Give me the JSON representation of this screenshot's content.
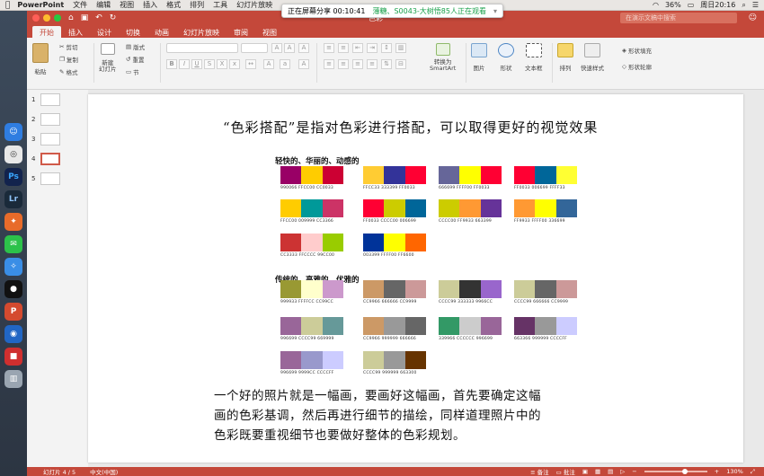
{
  "macbar": {
    "app": "PowerPoint",
    "menus": [
      "文件",
      "编辑",
      "视图",
      "插入",
      "格式",
      "排列",
      "工具",
      "幻灯片放映"
    ],
    "battery": "36%",
    "clock": "周日20:16"
  },
  "share": {
    "status": "正在屏幕分享 00:10:41",
    "live": "薄糖、S0043-大树悟85人正在观看"
  },
  "window": {
    "doc_title": "色彩",
    "search_placeholder": "在演示文稿中搜索",
    "tabs": [
      "开始",
      "插入",
      "设计",
      "切换",
      "动画",
      "幻灯片放映",
      "审阅",
      "视图"
    ],
    "active_tab": "开始"
  },
  "ribbon": {
    "paste": "粘贴",
    "cut": "剪切",
    "copy": "复制",
    "format": "格式",
    "new_slide": "新建\n幻灯片",
    "layout": "版式",
    "reset": "重置",
    "section": "节",
    "convert_smartart": "转换为\nSmartArt",
    "picture": "图片",
    "shapes": "形状",
    "textbox": "文本框",
    "arrange": "排列",
    "quick_styles": "快速样式",
    "shape_fill": "形状填充",
    "shape_outline": "形状轮廓"
  },
  "thumbnails": [
    {
      "num": "1",
      "selected": false
    },
    {
      "num": "2",
      "selected": false
    },
    {
      "num": "3",
      "selected": false
    },
    {
      "num": "4",
      "selected": true
    },
    {
      "num": "5",
      "selected": false
    }
  ],
  "slide": {
    "headline": "“色彩搭配”是指对色彩进行搭配，可以取得更好的视觉效果",
    "section1": "轻快的、华丽的、动感的",
    "section2": "传统的、高雅的、优雅的",
    "bottom_lines": [
      "一个好的照片就是一幅画，要画好这幅画，首先要确定这幅",
      "画的色彩基调，然后再进行细节的描绘，同样道理照片中的",
      "色彩既要重视细节也要做好整体的色彩规划。"
    ],
    "palettes": [
      {
        "colors": [
          "#990066",
          "#FFCC00",
          "#CC0033"
        ],
        "codes": "990066 FFCC00 CC0033"
      },
      {
        "colors": [
          "#FFCC33",
          "#333399",
          "#FF0033"
        ],
        "codes": "FFCC33 333399 FF0033"
      },
      {
        "colors": [
          "#666699",
          "#FFFF00",
          "#FF0033"
        ],
        "codes": "666699 FFFF00 FF0033"
      },
      {
        "colors": [
          "#FF0033",
          "#006699",
          "#FFFF33"
        ],
        "codes": "FF0033 006699 FFFF33"
      },
      {
        "colors": [
          "#FFCC00",
          "#009999",
          "#CC3366"
        ],
        "codes": "FFCC00 009999 CC3366"
      },
      {
        "colors": [
          "#FF0033",
          "#CCCC00",
          "#006699"
        ],
        "codes": "FF0033 CCCC00 006699"
      },
      {
        "colors": [
          "#CCCC00",
          "#FF9933",
          "#663399"
        ],
        "codes": "CCCC00 FF9933 663399"
      },
      {
        "colors": [
          "#FF9933",
          "#FFFF00",
          "#336699"
        ],
        "codes": "FF9933 FFFF00 336699"
      },
      {
        "colors": [
          "#CC3333",
          "#FFCCCC",
          "#99CC00"
        ],
        "codes": "CC3333 FFCCCC 99CC00"
      },
      {
        "colors": [
          "#003399",
          "#FFFF00",
          "#FF6600"
        ],
        "codes": "003399 FFFF00 FF6600"
      },
      {
        "colors": [
          "#999933",
          "#FFFFCC",
          "#CC99CC"
        ],
        "codes": "999933 FFFFCC CC99CC"
      },
      {
        "colors": [
          "#CC9966",
          "#666666",
          "#CC9999"
        ],
        "codes": "CC9966 666666 CC9999"
      },
      {
        "colors": [
          "#CCCC99",
          "#333333",
          "#9966CC"
        ],
        "codes": "CCCC99 333333 9966CC"
      },
      {
        "colors": [
          "#CCCC99",
          "#666666",
          "#CC9999"
        ],
        "codes": "CCCC99 666666 CC9999"
      },
      {
        "colors": [
          "#996699",
          "#CCCC99",
          "#669999"
        ],
        "codes": "996699 CCCC99 669999"
      },
      {
        "colors": [
          "#CC9966",
          "#999999",
          "#666666"
        ],
        "codes": "CC9966 999999 666666"
      },
      {
        "colors": [
          "#339966",
          "#CCCCCC",
          "#996699"
        ],
        "codes": "339966 CCCCCC 996699"
      },
      {
        "colors": [
          "#663366",
          "#999999",
          "#CCCCFF"
        ],
        "codes": "663366 999999 CCCCFF"
      },
      {
        "colors": [
          "#996699",
          "#9999CC",
          "#CCCCFF"
        ],
        "codes": "996699 9999CC CCCCFF"
      },
      {
        "colors": [
          "#CCCC99",
          "#999999",
          "#663300"
        ],
        "codes": "CCCC99 999999 663300"
      }
    ]
  },
  "status": {
    "slide_counter": "幻灯片 4 / 5",
    "language": "中文(中国)",
    "notes": "备注",
    "comments": "批注",
    "zoom": "130%"
  },
  "colors": {
    "accent": "#c4483a"
  }
}
